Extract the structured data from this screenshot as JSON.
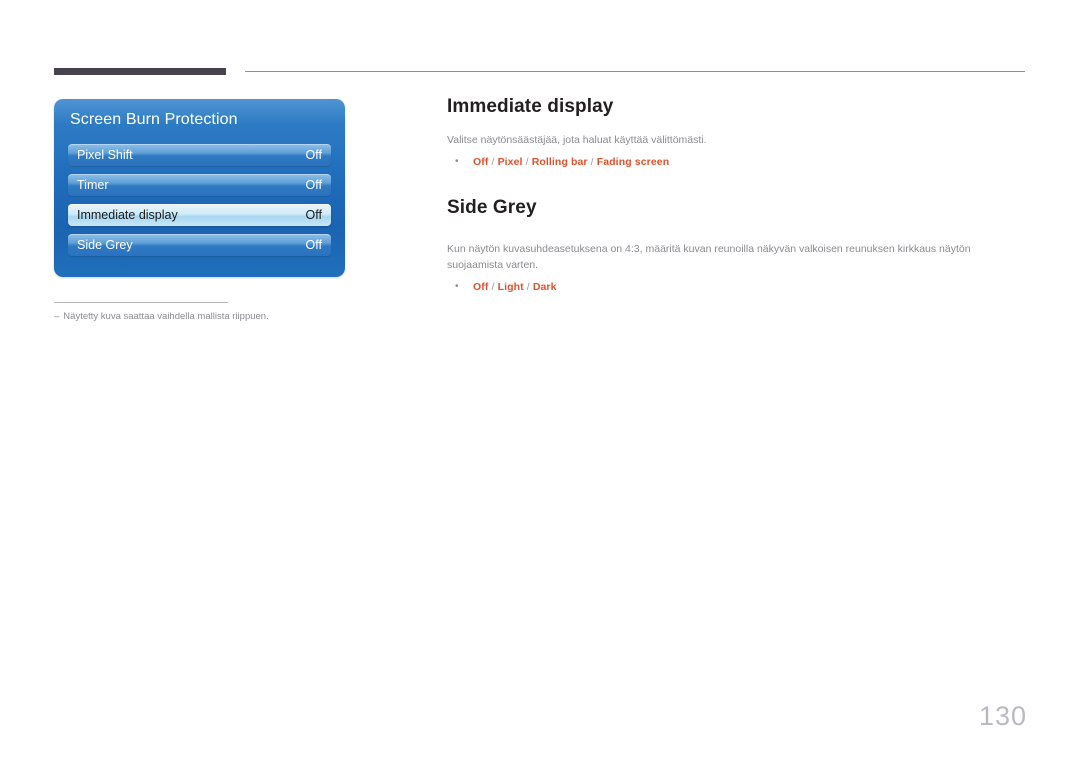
{
  "header": {
    "thick_rule_color": "#46434f",
    "thin_rule_color": "#8d8d94"
  },
  "osd_panel": {
    "title": "Screen Burn Protection",
    "accent_color": "#1f6cba",
    "rows": [
      {
        "label": "Pixel Shift",
        "value": "Off",
        "selected": false
      },
      {
        "label": "Timer",
        "value": "Off",
        "selected": false
      },
      {
        "label": "Immediate display",
        "value": "Off",
        "selected": true
      },
      {
        "label": "Side Grey",
        "value": "Off",
        "selected": false
      }
    ]
  },
  "footnote": {
    "dash": "–",
    "text": "Näytetty kuva saattaa vaihdella mallista riippuen."
  },
  "sections": [
    {
      "title": "Immediate display",
      "body": "Valitse näytönsäästäjää, jota haluat käyttää välittömästi.",
      "options": [
        "Off",
        "Pixel",
        "Rolling bar",
        "Fading screen"
      ],
      "options_text": "Off / Pixel / Rolling bar / Fading screen",
      "separator": "/"
    },
    {
      "title": "Side Grey",
      "body": "Kun näytön kuvasuhdeasetuksena on 4:3, määritä kuvan reunoilla näkyvän valkoisen reunuksen kirkkaus näytön suojaamista varten.",
      "options": [
        "Off",
        "Light",
        "Dark"
      ],
      "options_text": "Off / Light / Dark",
      "separator": "/"
    }
  ],
  "page_number": "130",
  "colors": {
    "option_orange": "#e0522b",
    "body_grey": "#8a8a90",
    "heading_dark": "#231f20",
    "page_number_grey": "#b9b9c2"
  }
}
